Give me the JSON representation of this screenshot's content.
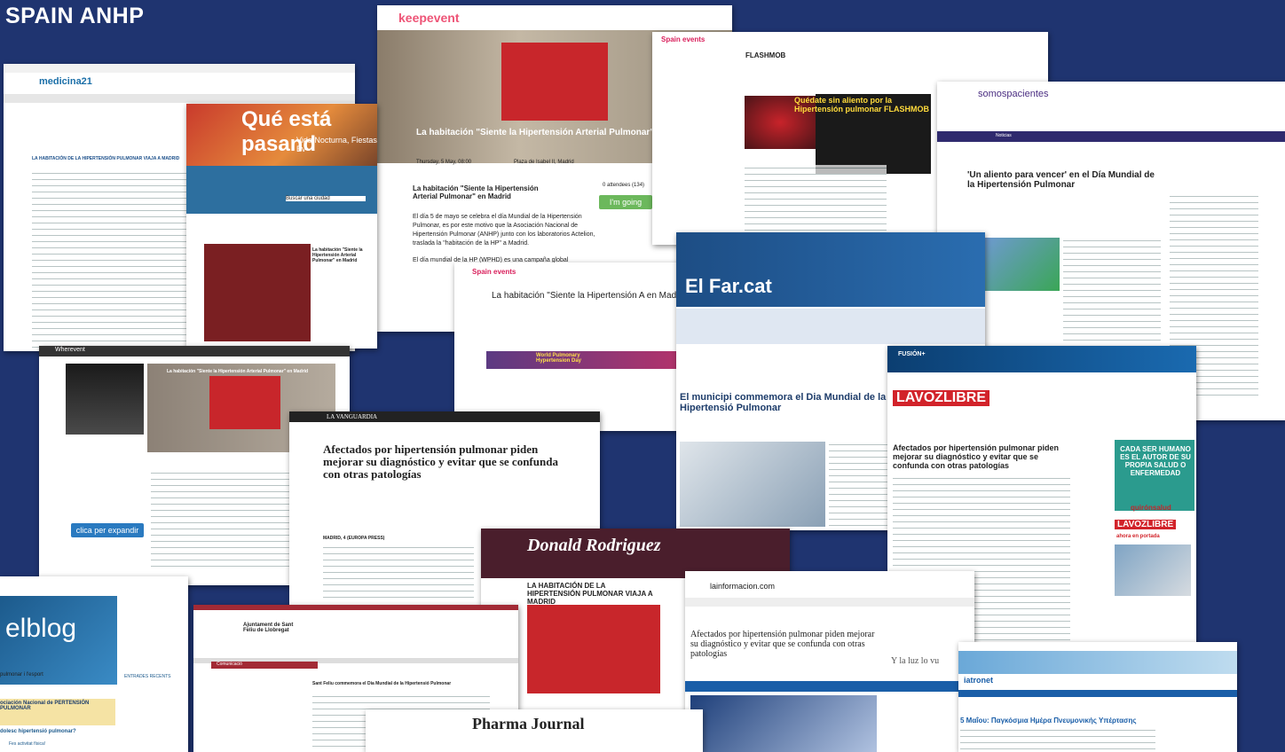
{
  "page_title": "SPAIN ANHP",
  "clippings": {
    "medicina21": {
      "logo": "medicina21",
      "headline": "LA HABITACIÓN DE LA HIPERTENSIÓN PULMONAR VIAJA A MADRID"
    },
    "que_esta": {
      "title": "Qué está pasand",
      "subtitle": "Vida Nocturna, Fiestas Ev",
      "search": "Buscar una ciudad",
      "caption": "La habitación \"Siente la Hipertensión Arterial Pulmonar\" en Madrid"
    },
    "keepevent": {
      "logo": "keepevent",
      "caption": "La habitación \"Siente la Hipertensión Arterial Pulmonar\" e",
      "date": "Thursday, 5 May, 08:00",
      "place": "Plaza de Isabel II, Madrid",
      "headline": "La habitación \"Siente la Hipertensión Arterial Pulmonar\" en Madrid",
      "body": "El día 5 de mayo se celebra el día Mundial de la Hipertensión Pulmonar, es por este motivo que la Asociación Nacional de Hipertensión Pulmonar (ANHP) junto con los laboratorios Actelion, traslada la \"habitación de la HP\" a Madrid.",
      "body2": "El día mundial de la HP (WPHD) es una campaña global",
      "attend": "0 attendees (134)",
      "going": "I'm going"
    },
    "spain_events_top": {
      "logo": "Spain events",
      "flashmob": "FLASHMOB",
      "bottom": "Quédate sin aliento por la Hipertensión pulmonar FLASHMOB"
    },
    "somos_pacientes": {
      "logo": "somospacientes",
      "nav": "Noticias",
      "headline": "'Un aliento para vencer' en el Día Mundial de la Hipertensión Pulmonar"
    },
    "wherevent": {
      "logo": "Wherevent",
      "caption": "La habitación \"Siente la Hipertensión Arterial Pulmonar\" en Madrid",
      "button": "clica per expandir"
    },
    "spain_events_mid": {
      "logo": "Spain events",
      "headline": "La habitación \"Siente la Hipertensión A en Madrid",
      "banner": "World Pulmonary Hypertension Day"
    },
    "elfar": {
      "logo": "El Far.cat",
      "headline": "El municipi commemora el Dia Mundial de la Hipertensió Pulmonar"
    },
    "lavanguardia": {
      "logo": "LA VANGUARDIA",
      "headline": "Afectados por hipertensión pulmonar piden mejorar su diagnóstico y evitar que se confunda con otras patologías",
      "dateline": "MADRID, 4 (EUROPA PRESS)"
    },
    "lavozlibre": {
      "banner": "FUSIÓN+",
      "logo": "LAVOZLIBRE",
      "headline": "Afectados por hipertensión pulmonar piden mejorar su diagnóstico y evitar que se confunda con otras patologías",
      "ad": "CADA SER HUMANO ES EL AUTOR DE SU PROPIA SALUD O ENFERMEDAD",
      "ad_logo": "quirónsalud",
      "side_logo": "LAVOZLIBRE",
      "side_sub": "ahora en portada"
    },
    "donald": {
      "logo": "Donald Rodriguez",
      "headline": "LA HABITACIÓN DE LA HIPERTENSIÓN PULMONAR VIAJA A MADRID"
    },
    "lainformacion": {
      "logo": "lainformacion.com",
      "headline": "Afectados por hipertensión pulmonar piden mejorar su diagnóstico y evitar que se confunda con otras patologías",
      "side": "Y la luz lo vu"
    },
    "elblog": {
      "logo": "elblog",
      "label": "pulmonar i l'esport",
      "side": "ENTRADES RECENTS",
      "banner": "ociación Nacional de PERTENSIÓN PULMONAR",
      "q": "dolesc hipertensió pulmonar?",
      "q2": "Fes activitat física!"
    },
    "santfeliu": {
      "logo": "Ajuntament de Sant Feliu de Llobregat",
      "menu": "Comunicació",
      "headline": "Sant Feliu commemora el Dia Mundial de la Hipertensió Pulmonar"
    },
    "pharma": {
      "logo": "Pharma Journal"
    },
    "iatronet": {
      "logo": "iatronet",
      "headline": "5 Μαΐου: Παγκόσμια Ημέρα Πνευμονικής Υπέρτασης"
    }
  }
}
